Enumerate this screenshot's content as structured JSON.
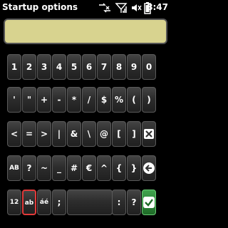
{
  "status": {
    "title": "Startup options",
    "time": "8:47",
    "icons": [
      "network-sync-icon",
      "signal-icon",
      "volume-icon",
      "battery-icon"
    ]
  },
  "display": {
    "value": ""
  },
  "keyboard": {
    "rows": [
      [
        "1",
        "2",
        "3",
        "4",
        "5",
        "6",
        "7",
        "8",
        "9",
        "0"
      ],
      [
        "'",
        "\"",
        "+",
        "-",
        "*",
        "/",
        "$",
        "%",
        "(",
        ")"
      ],
      [
        "<",
        "=",
        ">",
        "|",
        "&",
        "\\",
        "@",
        "[",
        "]"
      ],
      [
        "AB",
        "?",
        "~",
        "_",
        "#",
        "€",
        "^",
        "{",
        "}"
      ],
      [
        "12",
        "ab",
        "áé",
        ";",
        "",
        ":",
        "?"
      ]
    ],
    "icons": {
      "clear": "clear-x-icon",
      "back": "back-arrow-icon",
      "ok": "check-icon"
    },
    "selected_key": "ab"
  },
  "colors": {
    "display_bg": "#d8d38f",
    "ok_key": "#3fa34d",
    "selection": "#e23a3a"
  }
}
